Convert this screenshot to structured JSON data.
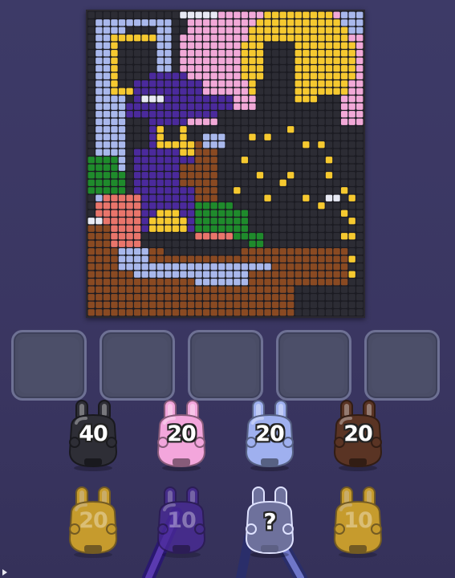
{
  "palette": {
    "black": "#2c2c34",
    "pink": "#f2a9d8",
    "lightblue": "#a9b8ec",
    "brown": "#8a4a22",
    "yellow": "#f6c930",
    "purple": "#4b2a9c",
    "green": "#1f8b2c",
    "salmon": "#e9756b",
    "white": "#e8eaf4"
  },
  "queue": {
    "row1": [
      {
        "color": "#2e2e36",
        "count": "40"
      },
      {
        "color": "#f3a6dc",
        "count": "20"
      },
      {
        "color": "#9fb0ef",
        "count": "20"
      },
      {
        "color": "#5a3424",
        "count": "20"
      }
    ],
    "row2": [
      {
        "color": "#f7bf1e",
        "count": "20"
      },
      {
        "color": "#4a2a9a",
        "count": "10"
      },
      {
        "color": "#a9aef0",
        "count": "?"
      },
      {
        "color": "#f7bf1e",
        "count": "10"
      }
    ]
  }
}
